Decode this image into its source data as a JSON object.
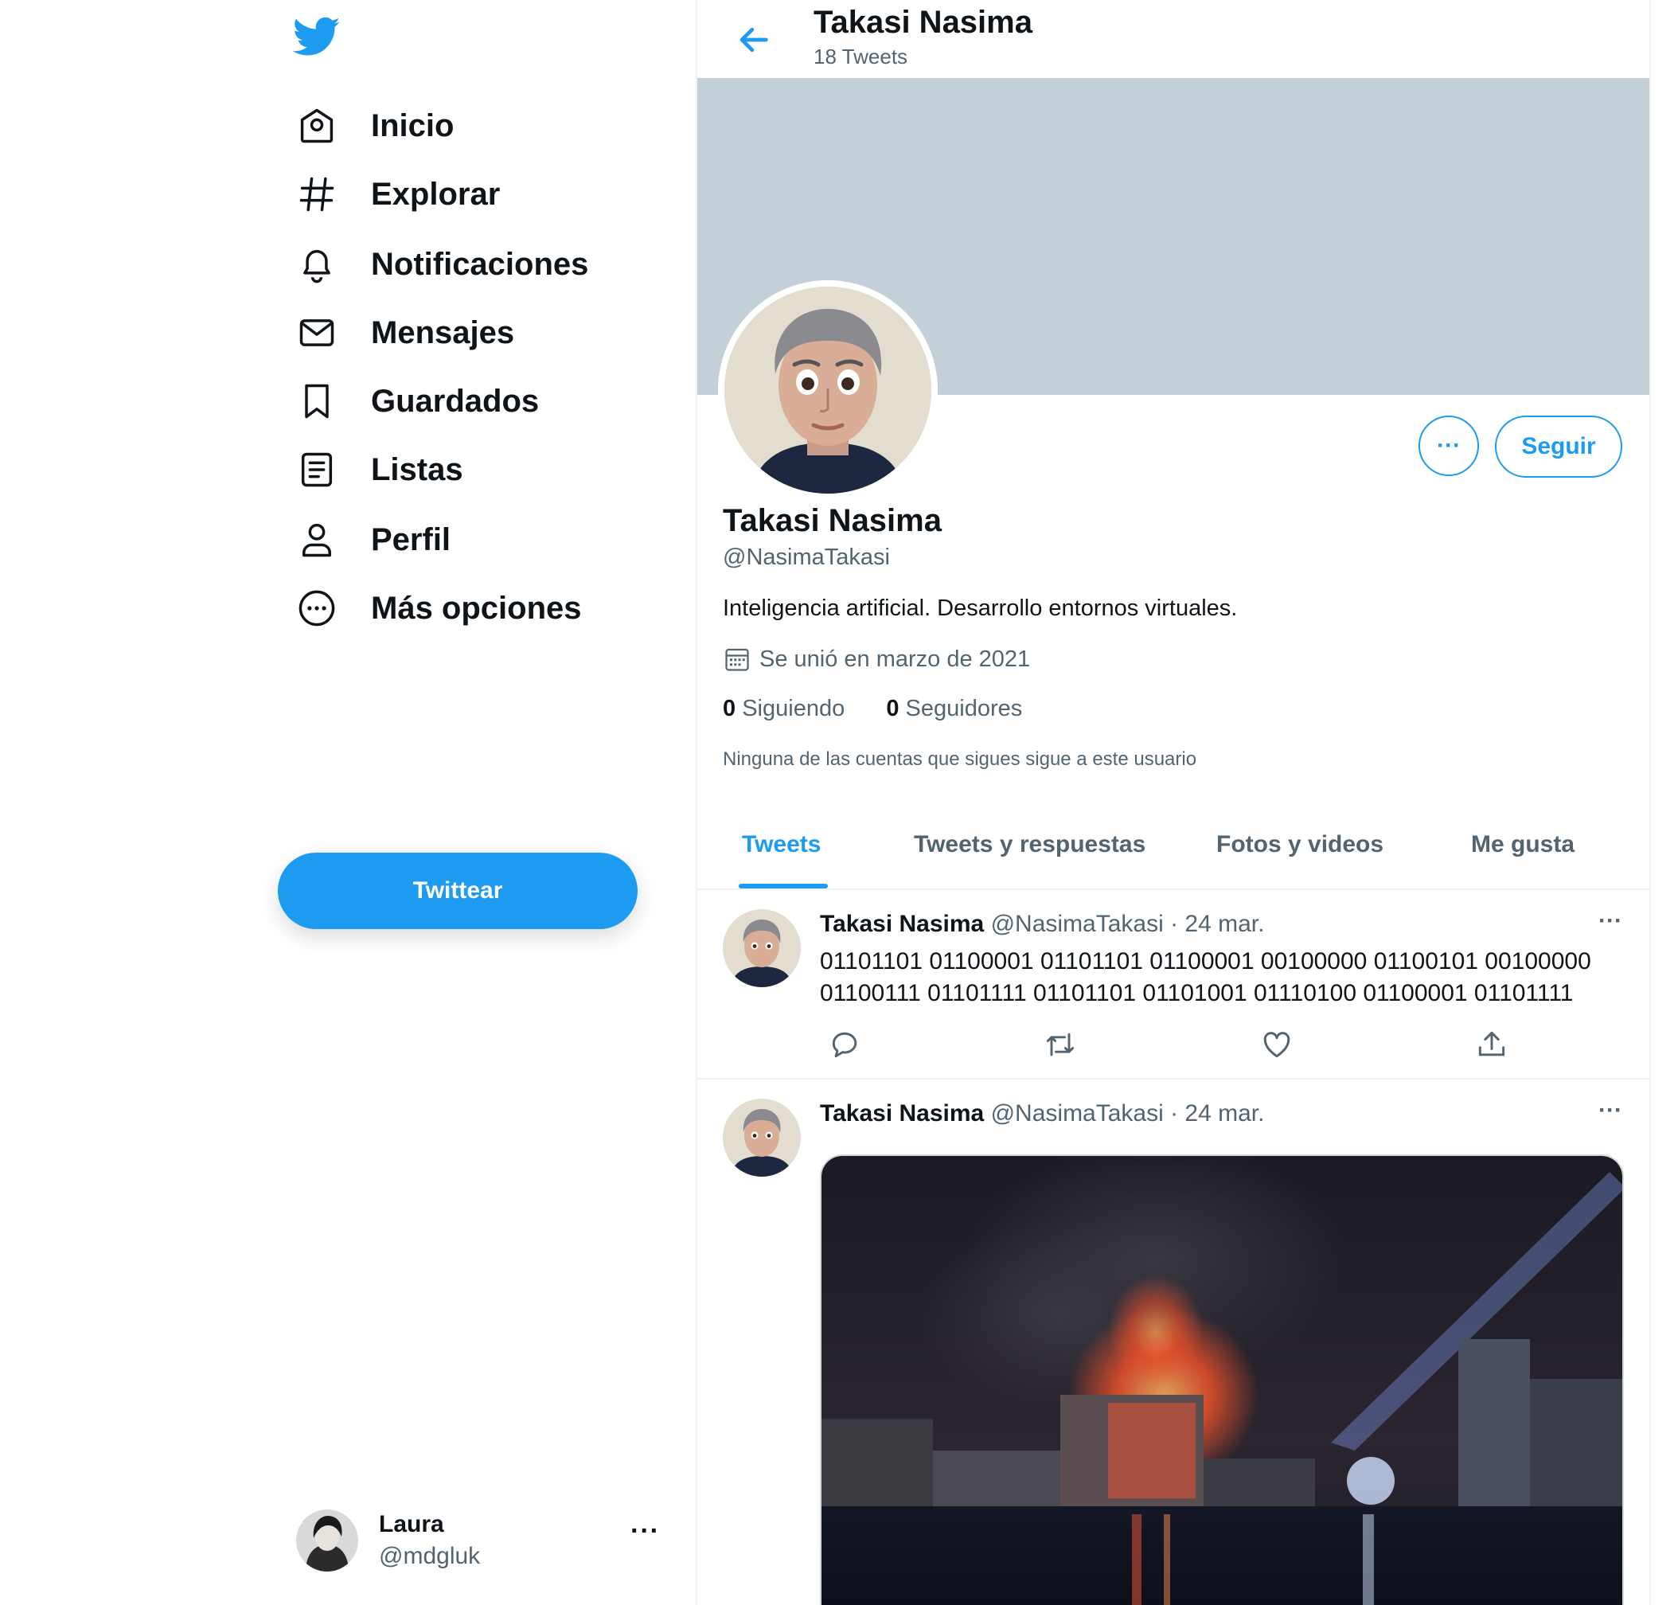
{
  "sidebar": {
    "logo_icon": "twitter-bird-icon",
    "nav": [
      {
        "label": "Inicio",
        "icon": "home-icon"
      },
      {
        "label": "Explorar",
        "icon": "hashtag-icon"
      },
      {
        "label": "Notificaciones",
        "icon": "bell-icon"
      },
      {
        "label": "Mensajes",
        "icon": "envelope-icon"
      },
      {
        "label": "Guardados",
        "icon": "bookmark-icon"
      },
      {
        "label": "Listas",
        "icon": "list-icon"
      },
      {
        "label": "Perfil",
        "icon": "person-icon"
      },
      {
        "label": "Más opciones",
        "icon": "more-circle-icon"
      }
    ],
    "tweet_button": "Twittear",
    "account": {
      "name": "Laura",
      "handle": "@mdgluk",
      "more": "···"
    }
  },
  "header": {
    "title": "Takasi Nasima",
    "subtitle": "18 Tweets"
  },
  "profile": {
    "name": "Takasi Nasima",
    "handle": "@NasimaTakasi",
    "bio": "Inteligencia artificial. Desarrollo entornos virtuales.",
    "joined": "Se unió en marzo de 2021",
    "following_count": "0",
    "following_label": "Siguiendo",
    "followers_count": "0",
    "followers_label": "Seguidores",
    "note": "Ninguna de las cuentas que sigues sigue a este usuario",
    "more_label": "···",
    "follow_label": "Seguir"
  },
  "tabs": [
    {
      "label": "Tweets",
      "active": true
    },
    {
      "label": "Tweets y respuestas",
      "active": false
    },
    {
      "label": "Fotos y videos",
      "active": false
    },
    {
      "label": "Me gusta",
      "active": false
    }
  ],
  "tweets": [
    {
      "name": "Takasi Nasima",
      "meta": "@NasimaTakasi · 24 mar.",
      "text": "01101101 01100001 01101101 01100001 00100000 01100101 00100000 01100111 01101111 01101101 01101001 01110100 01100001 01101111",
      "more": "···"
    },
    {
      "name": "Takasi Nasima",
      "meta": "@NasimaTakasi · 24 mar.",
      "more": "···",
      "media": "photo-building-fire-at-night"
    }
  ],
  "colors": {
    "accent": "#1d9bf0",
    "banner": "#c4d0d7",
    "muted": "#536471",
    "text": "#0f1419"
  }
}
